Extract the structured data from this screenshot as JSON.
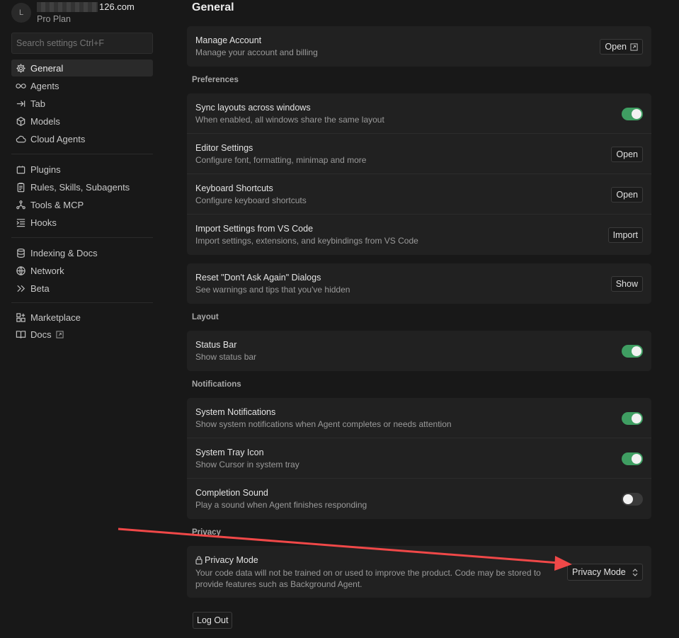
{
  "account": {
    "avatar_letter": "L",
    "email_suffix": "126.com",
    "plan": "Pro Plan"
  },
  "search": {
    "placeholder": "Search settings Ctrl+F"
  },
  "sidebar": {
    "items": [
      {
        "label": "General",
        "icon": "gear-icon"
      },
      {
        "label": "Agents",
        "icon": "infinity-icon"
      },
      {
        "label": "Tab",
        "icon": "tab-arrow-icon"
      },
      {
        "label": "Models",
        "icon": "cube-icon"
      },
      {
        "label": "Cloud Agents",
        "icon": "cloud-icon"
      },
      {
        "label": "Plugins",
        "icon": "plugin-icon"
      },
      {
        "label": "Rules, Skills, Subagents",
        "icon": "clipboard-icon"
      },
      {
        "label": "Tools & MCP",
        "icon": "nodes-icon"
      },
      {
        "label": "Hooks",
        "icon": "hooks-icon"
      },
      {
        "label": "Indexing & Docs",
        "icon": "database-icon"
      },
      {
        "label": "Network",
        "icon": "globe-icon"
      },
      {
        "label": "Beta",
        "icon": "double-chevron-icon"
      },
      {
        "label": "Marketplace",
        "icon": "grid-plus-icon"
      },
      {
        "label": "Docs",
        "icon": "book-icon"
      }
    ]
  },
  "main": {
    "title": "General",
    "manage": {
      "title": "Manage Account",
      "desc": "Manage your account and billing",
      "button": "Open"
    },
    "preferences": {
      "label": "Preferences",
      "rows": [
        {
          "title": "Sync layouts across windows",
          "desc": "When enabled, all windows share the same layout",
          "control": "toggle",
          "on": true
        },
        {
          "title": "Editor Settings",
          "desc": "Configure font, formatting, minimap and more",
          "button": "Open"
        },
        {
          "title": "Keyboard Shortcuts",
          "desc": "Configure keyboard shortcuts",
          "button": "Open"
        },
        {
          "title": "Import Settings from VS Code",
          "desc": "Import settings, extensions, and keybindings from VS Code",
          "button": "Import"
        }
      ]
    },
    "reset": {
      "title": "Reset \"Don't Ask Again\" Dialogs",
      "desc": "See warnings and tips that you've hidden",
      "button": "Show"
    },
    "layout": {
      "label": "Layout",
      "rows": [
        {
          "title": "Status Bar",
          "desc": "Show status bar",
          "on": true
        }
      ]
    },
    "notifications": {
      "label": "Notifications",
      "rows": [
        {
          "title": "System Notifications",
          "desc": "Show system notifications when Agent completes or needs attention",
          "on": true
        },
        {
          "title": "System Tray Icon",
          "desc": "Show Cursor in system tray",
          "on": true
        },
        {
          "title": "Completion Sound",
          "desc": "Play a sound when Agent finishes responding",
          "on": false
        }
      ]
    },
    "privacy": {
      "label": "Privacy",
      "title": "Privacy Mode",
      "desc_line1": "Your code data will not be trained on or used to improve the product. Code may be stored to",
      "desc_line2": "provide features such as Background Agent.",
      "select_value": "Privacy Mode"
    },
    "logout": "Log Out"
  },
  "colors": {
    "toggle_on": "#3f9e62",
    "annotation_arrow": "#f04848"
  }
}
